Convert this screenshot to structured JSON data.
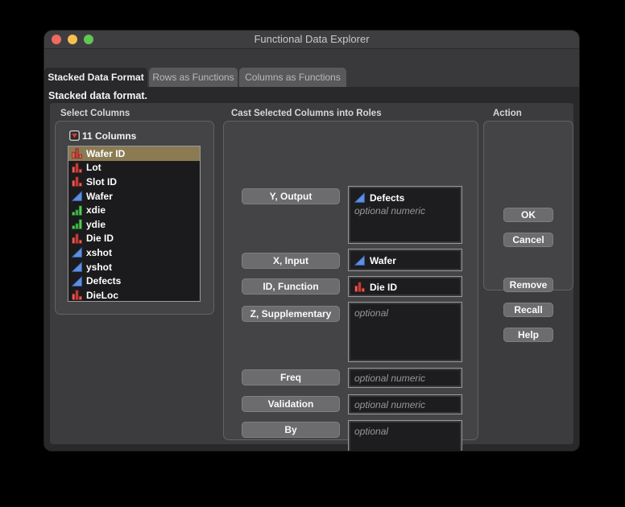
{
  "window": {
    "title": "Functional Data Explorer"
  },
  "traffic_lights": {
    "close": "close",
    "minimize": "minimize",
    "zoom": "zoom"
  },
  "tabs": [
    {
      "label": "Stacked Data Format",
      "active": true
    },
    {
      "label": "Rows as Functions",
      "active": false
    },
    {
      "label": "Columns as Functions",
      "active": false
    }
  ],
  "subtitle": "Stacked data format.",
  "select_columns": {
    "label": "Select Columns",
    "count_label": "11 Columns",
    "items": [
      {
        "name": "Wafer ID",
        "type": "nominal",
        "selected": true
      },
      {
        "name": "Lot",
        "type": "nominal",
        "selected": false
      },
      {
        "name": "Slot ID",
        "type": "nominal",
        "selected": false
      },
      {
        "name": "Wafer",
        "type": "continuous",
        "selected": false
      },
      {
        "name": "xdie",
        "type": "ordinal",
        "selected": false
      },
      {
        "name": "ydie",
        "type": "ordinal",
        "selected": false
      },
      {
        "name": "Die ID",
        "type": "nominal",
        "selected": false
      },
      {
        "name": "xshot",
        "type": "continuous",
        "selected": false
      },
      {
        "name": "yshot",
        "type": "continuous",
        "selected": false
      },
      {
        "name": "Defects",
        "type": "continuous",
        "selected": false
      },
      {
        "name": "DieLoc",
        "type": "nominal",
        "selected": false
      }
    ]
  },
  "cast_roles": {
    "label": "Cast Selected Columns into Roles",
    "roles": [
      {
        "button": "Y, Output",
        "entries": [
          {
            "name": "Defects",
            "type": "continuous"
          }
        ],
        "placeholder": "optional numeric"
      },
      {
        "button": "X, Input",
        "entries": [
          {
            "name": "Wafer",
            "type": "continuous"
          }
        ],
        "placeholder": ""
      },
      {
        "button": "ID, Function",
        "entries": [
          {
            "name": "Die ID",
            "type": "nominal"
          }
        ],
        "placeholder": ""
      },
      {
        "button": "Z, Supplementary",
        "entries": [],
        "placeholder": "optional"
      },
      {
        "button": "Freq",
        "entries": [],
        "placeholder": "optional numeric"
      },
      {
        "button": "Validation",
        "entries": [],
        "placeholder": "optional numeric"
      },
      {
        "button": "By",
        "entries": [],
        "placeholder": "optional"
      }
    ]
  },
  "action": {
    "label": "Action",
    "buttons": {
      "ok": "OK",
      "cancel": "Cancel",
      "remove": "Remove",
      "recall": "Recall",
      "help": "Help"
    }
  },
  "colors": {
    "selection_highlight": "#8b7b53",
    "continuous_icon_blue": "#5e8fe0",
    "nominal_icon_red": "#d0504a",
    "ordinal_icon_green": "#44b44c",
    "traffic_red": "#ee6a5f",
    "traffic_yellow": "#f5bf4f",
    "traffic_green": "#62c555"
  }
}
